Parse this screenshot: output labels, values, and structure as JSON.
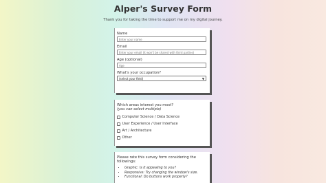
{
  "header": {
    "title": "Alper's Survey Form",
    "subtitle": "Thank you for taking the time to support me on my digital journey."
  },
  "form": {
    "name": {
      "label": "Name",
      "placeholder": "Enter your name"
    },
    "email": {
      "label": "Email",
      "placeholder": "Enter your email (it won't be shared with third parties)"
    },
    "age": {
      "label": "Age (optional)",
      "placeholder": "Age"
    },
    "occupation": {
      "label": "What's your occupation?",
      "selected": "(select your field)"
    },
    "interests": {
      "question": "Which areas interest you most?",
      "hint": "(you can select multiple)",
      "options": [
        "Computer Science / Data Science",
        "User Experience / User Interface",
        "Art / Architecture",
        "Other"
      ]
    },
    "rating": {
      "intro": "Please rate this survey form considering the followings:",
      "criteria": [
        {
          "key": "Graphic:",
          "text": "Is it appealing to you?"
        },
        {
          "key": "Responsive:",
          "text": "Try changing the window's size."
        },
        {
          "key": "Functional:",
          "text": "Do buttons work properly?"
        }
      ]
    }
  }
}
